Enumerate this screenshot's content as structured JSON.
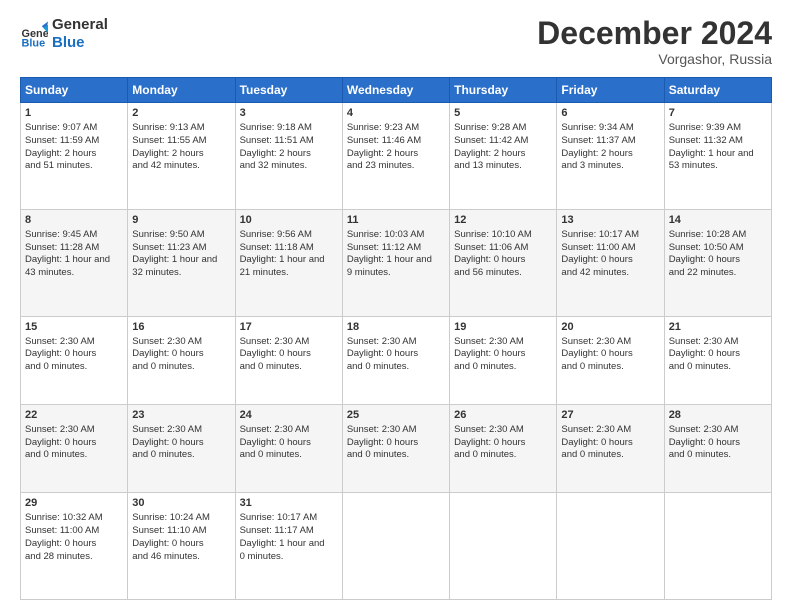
{
  "logo": {
    "line1": "General",
    "line2": "Blue"
  },
  "title": "December 2024",
  "subtitle": "Vorgashor, Russia",
  "days_header": [
    "Sunday",
    "Monday",
    "Tuesday",
    "Wednesday",
    "Thursday",
    "Friday",
    "Saturday"
  ],
  "weeks": [
    [
      {
        "day": "1",
        "lines": [
          "Sunrise: 9:07 AM",
          "Sunset: 11:59 AM",
          "Daylight: 2 hours",
          "and 51 minutes."
        ]
      },
      {
        "day": "2",
        "lines": [
          "Sunrise: 9:13 AM",
          "Sunset: 11:55 AM",
          "Daylight: 2 hours",
          "and 42 minutes."
        ]
      },
      {
        "day": "3",
        "lines": [
          "Sunrise: 9:18 AM",
          "Sunset: 11:51 AM",
          "Daylight: 2 hours",
          "and 32 minutes."
        ]
      },
      {
        "day": "4",
        "lines": [
          "Sunrise: 9:23 AM",
          "Sunset: 11:46 AM",
          "Daylight: 2 hours",
          "and 23 minutes."
        ]
      },
      {
        "day": "5",
        "lines": [
          "Sunrise: 9:28 AM",
          "Sunset: 11:42 AM",
          "Daylight: 2 hours",
          "and 13 minutes."
        ]
      },
      {
        "day": "6",
        "lines": [
          "Sunrise: 9:34 AM",
          "Sunset: 11:37 AM",
          "Daylight: 2 hours",
          "and 3 minutes."
        ]
      },
      {
        "day": "7",
        "lines": [
          "Sunrise: 9:39 AM",
          "Sunset: 11:32 AM",
          "Daylight: 1 hour and",
          "53 minutes."
        ]
      }
    ],
    [
      {
        "day": "8",
        "lines": [
          "Sunrise: 9:45 AM",
          "Sunset: 11:28 AM",
          "Daylight: 1 hour and",
          "43 minutes."
        ]
      },
      {
        "day": "9",
        "lines": [
          "Sunrise: 9:50 AM",
          "Sunset: 11:23 AM",
          "Daylight: 1 hour and",
          "32 minutes."
        ]
      },
      {
        "day": "10",
        "lines": [
          "Sunrise: 9:56 AM",
          "Sunset: 11:18 AM",
          "Daylight: 1 hour and",
          "21 minutes."
        ]
      },
      {
        "day": "11",
        "lines": [
          "Sunrise: 10:03 AM",
          "Sunset: 11:12 AM",
          "Daylight: 1 hour and",
          "9 minutes."
        ]
      },
      {
        "day": "12",
        "lines": [
          "Sunrise: 10:10 AM",
          "Sunset: 11:06 AM",
          "Daylight: 0 hours",
          "and 56 minutes."
        ]
      },
      {
        "day": "13",
        "lines": [
          "Sunrise: 10:17 AM",
          "Sunset: 11:00 AM",
          "Daylight: 0 hours",
          "and 42 minutes."
        ]
      },
      {
        "day": "14",
        "lines": [
          "Sunrise: 10:28 AM",
          "Sunset: 10:50 AM",
          "Daylight: 0 hours",
          "and 22 minutes."
        ]
      }
    ],
    [
      {
        "day": "15",
        "lines": [
          "Sunset: 2:30 AM",
          "Daylight: 0 hours",
          "and 0 minutes."
        ]
      },
      {
        "day": "16",
        "lines": [
          "Sunset: 2:30 AM",
          "Daylight: 0 hours",
          "and 0 minutes."
        ]
      },
      {
        "day": "17",
        "lines": [
          "Sunset: 2:30 AM",
          "Daylight: 0 hours",
          "and 0 minutes."
        ]
      },
      {
        "day": "18",
        "lines": [
          "Sunset: 2:30 AM",
          "Daylight: 0 hours",
          "and 0 minutes."
        ]
      },
      {
        "day": "19",
        "lines": [
          "Sunset: 2:30 AM",
          "Daylight: 0 hours",
          "and 0 minutes."
        ]
      },
      {
        "day": "20",
        "lines": [
          "Sunset: 2:30 AM",
          "Daylight: 0 hours",
          "and 0 minutes."
        ]
      },
      {
        "day": "21",
        "lines": [
          "Sunset: 2:30 AM",
          "Daylight: 0 hours",
          "and 0 minutes."
        ]
      }
    ],
    [
      {
        "day": "22",
        "lines": [
          "Sunset: 2:30 AM",
          "Daylight: 0 hours",
          "and 0 minutes."
        ]
      },
      {
        "day": "23",
        "lines": [
          "Sunset: 2:30 AM",
          "Daylight: 0 hours",
          "and 0 minutes."
        ]
      },
      {
        "day": "24",
        "lines": [
          "Sunset: 2:30 AM",
          "Daylight: 0 hours",
          "and 0 minutes."
        ]
      },
      {
        "day": "25",
        "lines": [
          "Sunset: 2:30 AM",
          "Daylight: 0 hours",
          "and 0 minutes."
        ]
      },
      {
        "day": "26",
        "lines": [
          "Sunset: 2:30 AM",
          "Daylight: 0 hours",
          "and 0 minutes."
        ]
      },
      {
        "day": "27",
        "lines": [
          "Sunset: 2:30 AM",
          "Daylight: 0 hours",
          "and 0 minutes."
        ]
      },
      {
        "day": "28",
        "lines": [
          "Sunset: 2:30 AM",
          "Daylight: 0 hours",
          "and 0 minutes."
        ]
      }
    ],
    [
      {
        "day": "29",
        "lines": [
          "Sunrise: 10:32 AM",
          "Sunset: 11:00 AM",
          "Daylight: 0 hours",
          "and 28 minutes."
        ]
      },
      {
        "day": "30",
        "lines": [
          "Sunrise: 10:24 AM",
          "Sunset: 11:10 AM",
          "Daylight: 0 hours",
          "and 46 minutes."
        ]
      },
      {
        "day": "31",
        "lines": [
          "Sunrise: 10:17 AM",
          "Sunset: 11:17 AM",
          "Daylight: 1 hour and",
          "0 minutes."
        ]
      },
      {
        "day": "",
        "lines": []
      },
      {
        "day": "",
        "lines": []
      },
      {
        "day": "",
        "lines": []
      },
      {
        "day": "",
        "lines": []
      }
    ]
  ]
}
